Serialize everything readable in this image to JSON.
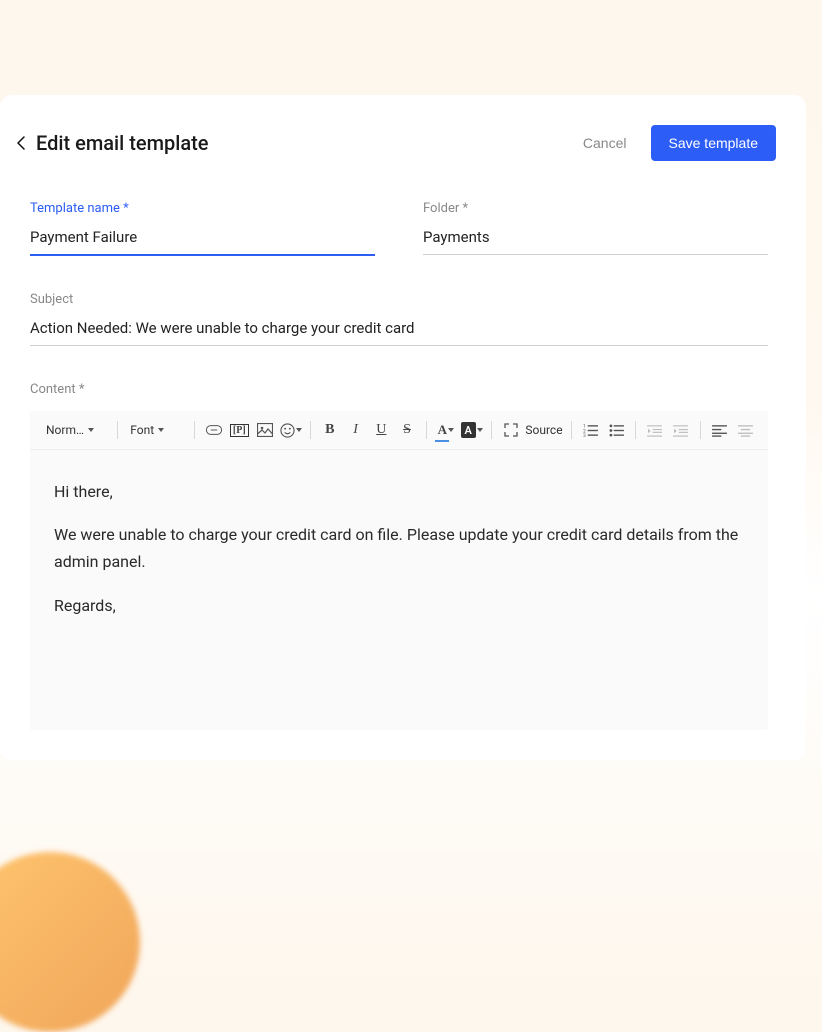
{
  "header": {
    "title": "Edit email template",
    "cancel": "Cancel",
    "save": "Save template"
  },
  "fields": {
    "template_name": {
      "label": "Template name *",
      "value": "Payment Failure"
    },
    "folder": {
      "label": "Folder *",
      "value": "Payments"
    },
    "subject": {
      "label": "Subject",
      "value": "Action Needed: We were unable to charge your credit card"
    },
    "content": {
      "label": "Content *"
    }
  },
  "toolbar": {
    "style": "Norm…",
    "font": "Font",
    "source": "Source"
  },
  "editor": {
    "p1": "Hi there,",
    "p2": "We were unable to charge your credit card on file. Please update your credit card details from the admin panel.",
    "p3": "Regards,"
  }
}
